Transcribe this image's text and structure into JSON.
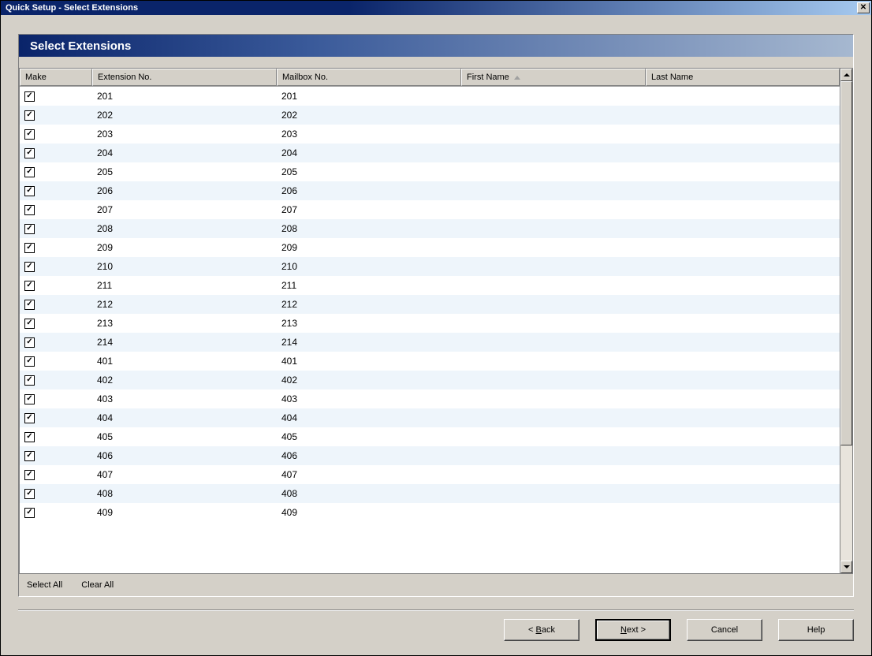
{
  "window": {
    "title": "Quick Setup - Select Extensions"
  },
  "panel": {
    "title": "Select Extensions"
  },
  "columns": {
    "make": "Make",
    "ext": "Extension No.",
    "mail": "Mailbox No.",
    "first": "First Name",
    "last": "Last Name"
  },
  "sort": {
    "column": "first",
    "direction": "asc"
  },
  "rows": [
    {
      "checked": true,
      "ext": "201",
      "mail": "201",
      "first": "",
      "last": ""
    },
    {
      "checked": true,
      "ext": "202",
      "mail": "202",
      "first": "",
      "last": ""
    },
    {
      "checked": true,
      "ext": "203",
      "mail": "203",
      "first": "",
      "last": ""
    },
    {
      "checked": true,
      "ext": "204",
      "mail": "204",
      "first": "",
      "last": ""
    },
    {
      "checked": true,
      "ext": "205",
      "mail": "205",
      "first": "",
      "last": ""
    },
    {
      "checked": true,
      "ext": "206",
      "mail": "206",
      "first": "",
      "last": ""
    },
    {
      "checked": true,
      "ext": "207",
      "mail": "207",
      "first": "",
      "last": ""
    },
    {
      "checked": true,
      "ext": "208",
      "mail": "208",
      "first": "",
      "last": ""
    },
    {
      "checked": true,
      "ext": "209",
      "mail": "209",
      "first": "",
      "last": ""
    },
    {
      "checked": true,
      "ext": "210",
      "mail": "210",
      "first": "",
      "last": ""
    },
    {
      "checked": true,
      "ext": "211",
      "mail": "211",
      "first": "",
      "last": ""
    },
    {
      "checked": true,
      "ext": "212",
      "mail": "212",
      "first": "",
      "last": ""
    },
    {
      "checked": true,
      "ext": "213",
      "mail": "213",
      "first": "",
      "last": ""
    },
    {
      "checked": true,
      "ext": "214",
      "mail": "214",
      "first": "",
      "last": ""
    },
    {
      "checked": true,
      "ext": "401",
      "mail": "401",
      "first": "",
      "last": ""
    },
    {
      "checked": true,
      "ext": "402",
      "mail": "402",
      "first": "",
      "last": ""
    },
    {
      "checked": true,
      "ext": "403",
      "mail": "403",
      "first": "",
      "last": ""
    },
    {
      "checked": true,
      "ext": "404",
      "mail": "404",
      "first": "",
      "last": ""
    },
    {
      "checked": true,
      "ext": "405",
      "mail": "405",
      "first": "",
      "last": ""
    },
    {
      "checked": true,
      "ext": "406",
      "mail": "406",
      "first": "",
      "last": ""
    },
    {
      "checked": true,
      "ext": "407",
      "mail": "407",
      "first": "",
      "last": ""
    },
    {
      "checked": true,
      "ext": "408",
      "mail": "408",
      "first": "",
      "last": ""
    },
    {
      "checked": true,
      "ext": "409",
      "mail": "409",
      "first": "",
      "last": ""
    }
  ],
  "toolbar": {
    "select_all": "Select All",
    "clear_all": "Clear All"
  },
  "wizard": {
    "back": "< Back",
    "next": "Next >",
    "cancel": "Cancel",
    "help": "Help",
    "back_u": "B",
    "next_u": "N"
  }
}
